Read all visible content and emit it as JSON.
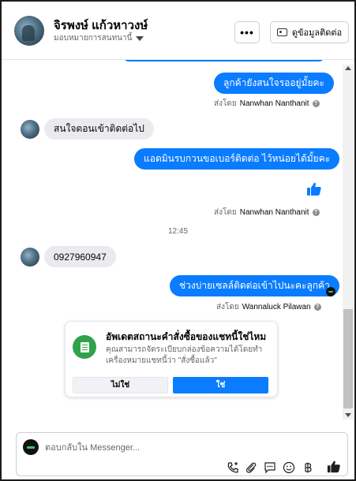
{
  "header": {
    "name": "จิรพงษ์ แก้วหาวงษ์",
    "assign_label": "มอบหมายการสนทนานี้",
    "more_label": "•••",
    "contact_button_label": "ดูข้อมูลติดต่อ"
  },
  "messages": {
    "out1": "ลูกค้ายังสนใจรออยู่มั้ยคะ",
    "sent_by_1_prefix": "ส่งโดย",
    "sent_by_1_name": "Nanwhan Nanthanit",
    "in1": "สนใจตอนเข้าติดต่อไป",
    "out2": "แอดมินรบกวนขอเบอร์ติดต่อ ไว้หน่อยได้มั้ยคะ",
    "sent_by_2_prefix": "ส่งโดย",
    "sent_by_2_name": "Nanwhan Nanthanit",
    "timestamp": "12:45",
    "in2": "0927960947",
    "out3": "ช่วงบ่ายเซลล์ติดต่อเข้าไปนะคะลูกค้า",
    "sent_by_3_prefix": "ส่งโดย",
    "sent_by_3_name": "Wannaluck Pilawan"
  },
  "status_card": {
    "title": "อัพเดตสถานะคำสั่งซื้อของแชทนี้ใช่ไหม",
    "description": "คุณสามารถจัดระเบียบกล่องข้อความได้โดยทำเครื่องหมายแชทนี้ว่า \"สั่งซื้อแล้ว\"",
    "no_label": "ไม่ใช่",
    "yes_label": "ใช่"
  },
  "composer": {
    "placeholder": "ตอบกลับใน Messenger..."
  },
  "colors": {
    "accent": "#0a7cff",
    "incoming_bubble": "#e9ebee",
    "card_icon": "#31a24c"
  },
  "icons": {
    "composer_tools": [
      "phone-plus-icon",
      "attachment-icon",
      "quick-reply-icon",
      "emoji-icon",
      "baht-icon",
      "thumbs-up-icon"
    ]
  }
}
